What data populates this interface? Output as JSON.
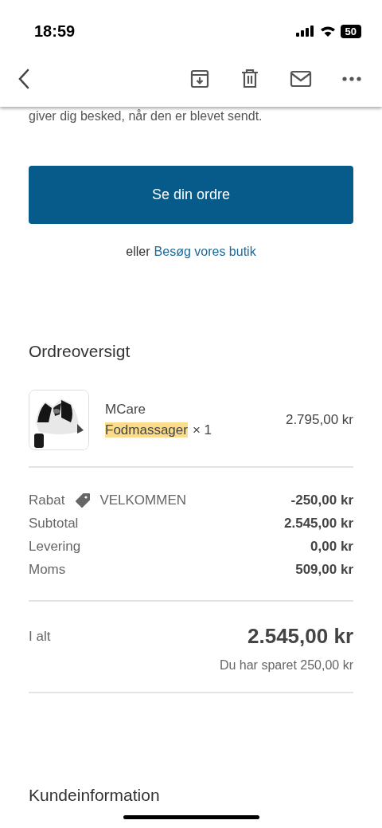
{
  "status_bar": {
    "time": "18:59",
    "battery": "50"
  },
  "email": {
    "message": "giver dig besked, når den er blevet sendt.",
    "button": "Se din ordre",
    "alt_prefix": "eller",
    "alt_link": "Besøg vores butik"
  },
  "order": {
    "heading": "Ordreoversigt",
    "item": {
      "kind": "picture",
      "brand": "MCare",
      "name": "Fodmassager",
      "highlighted": true,
      "quantity": "× 1",
      "price": "2.795,00 kr"
    },
    "lines": [
      {
        "label": "Rabat",
        "code": "VELKOMMEN",
        "value": "-250,00 kr"
      },
      {
        "label": "Subtotal",
        "value": "2.545,00 kr"
      },
      {
        "label": "Levering",
        "value": "0,00 kr"
      },
      {
        "label": "Moms",
        "value": "509,00 kr"
      }
    ],
    "total_label": "I alt",
    "total": "2.545,00 kr",
    "savings": "Du har sparet 250,00 kr"
  },
  "customer": {
    "heading": "Kundeinformation"
  }
}
